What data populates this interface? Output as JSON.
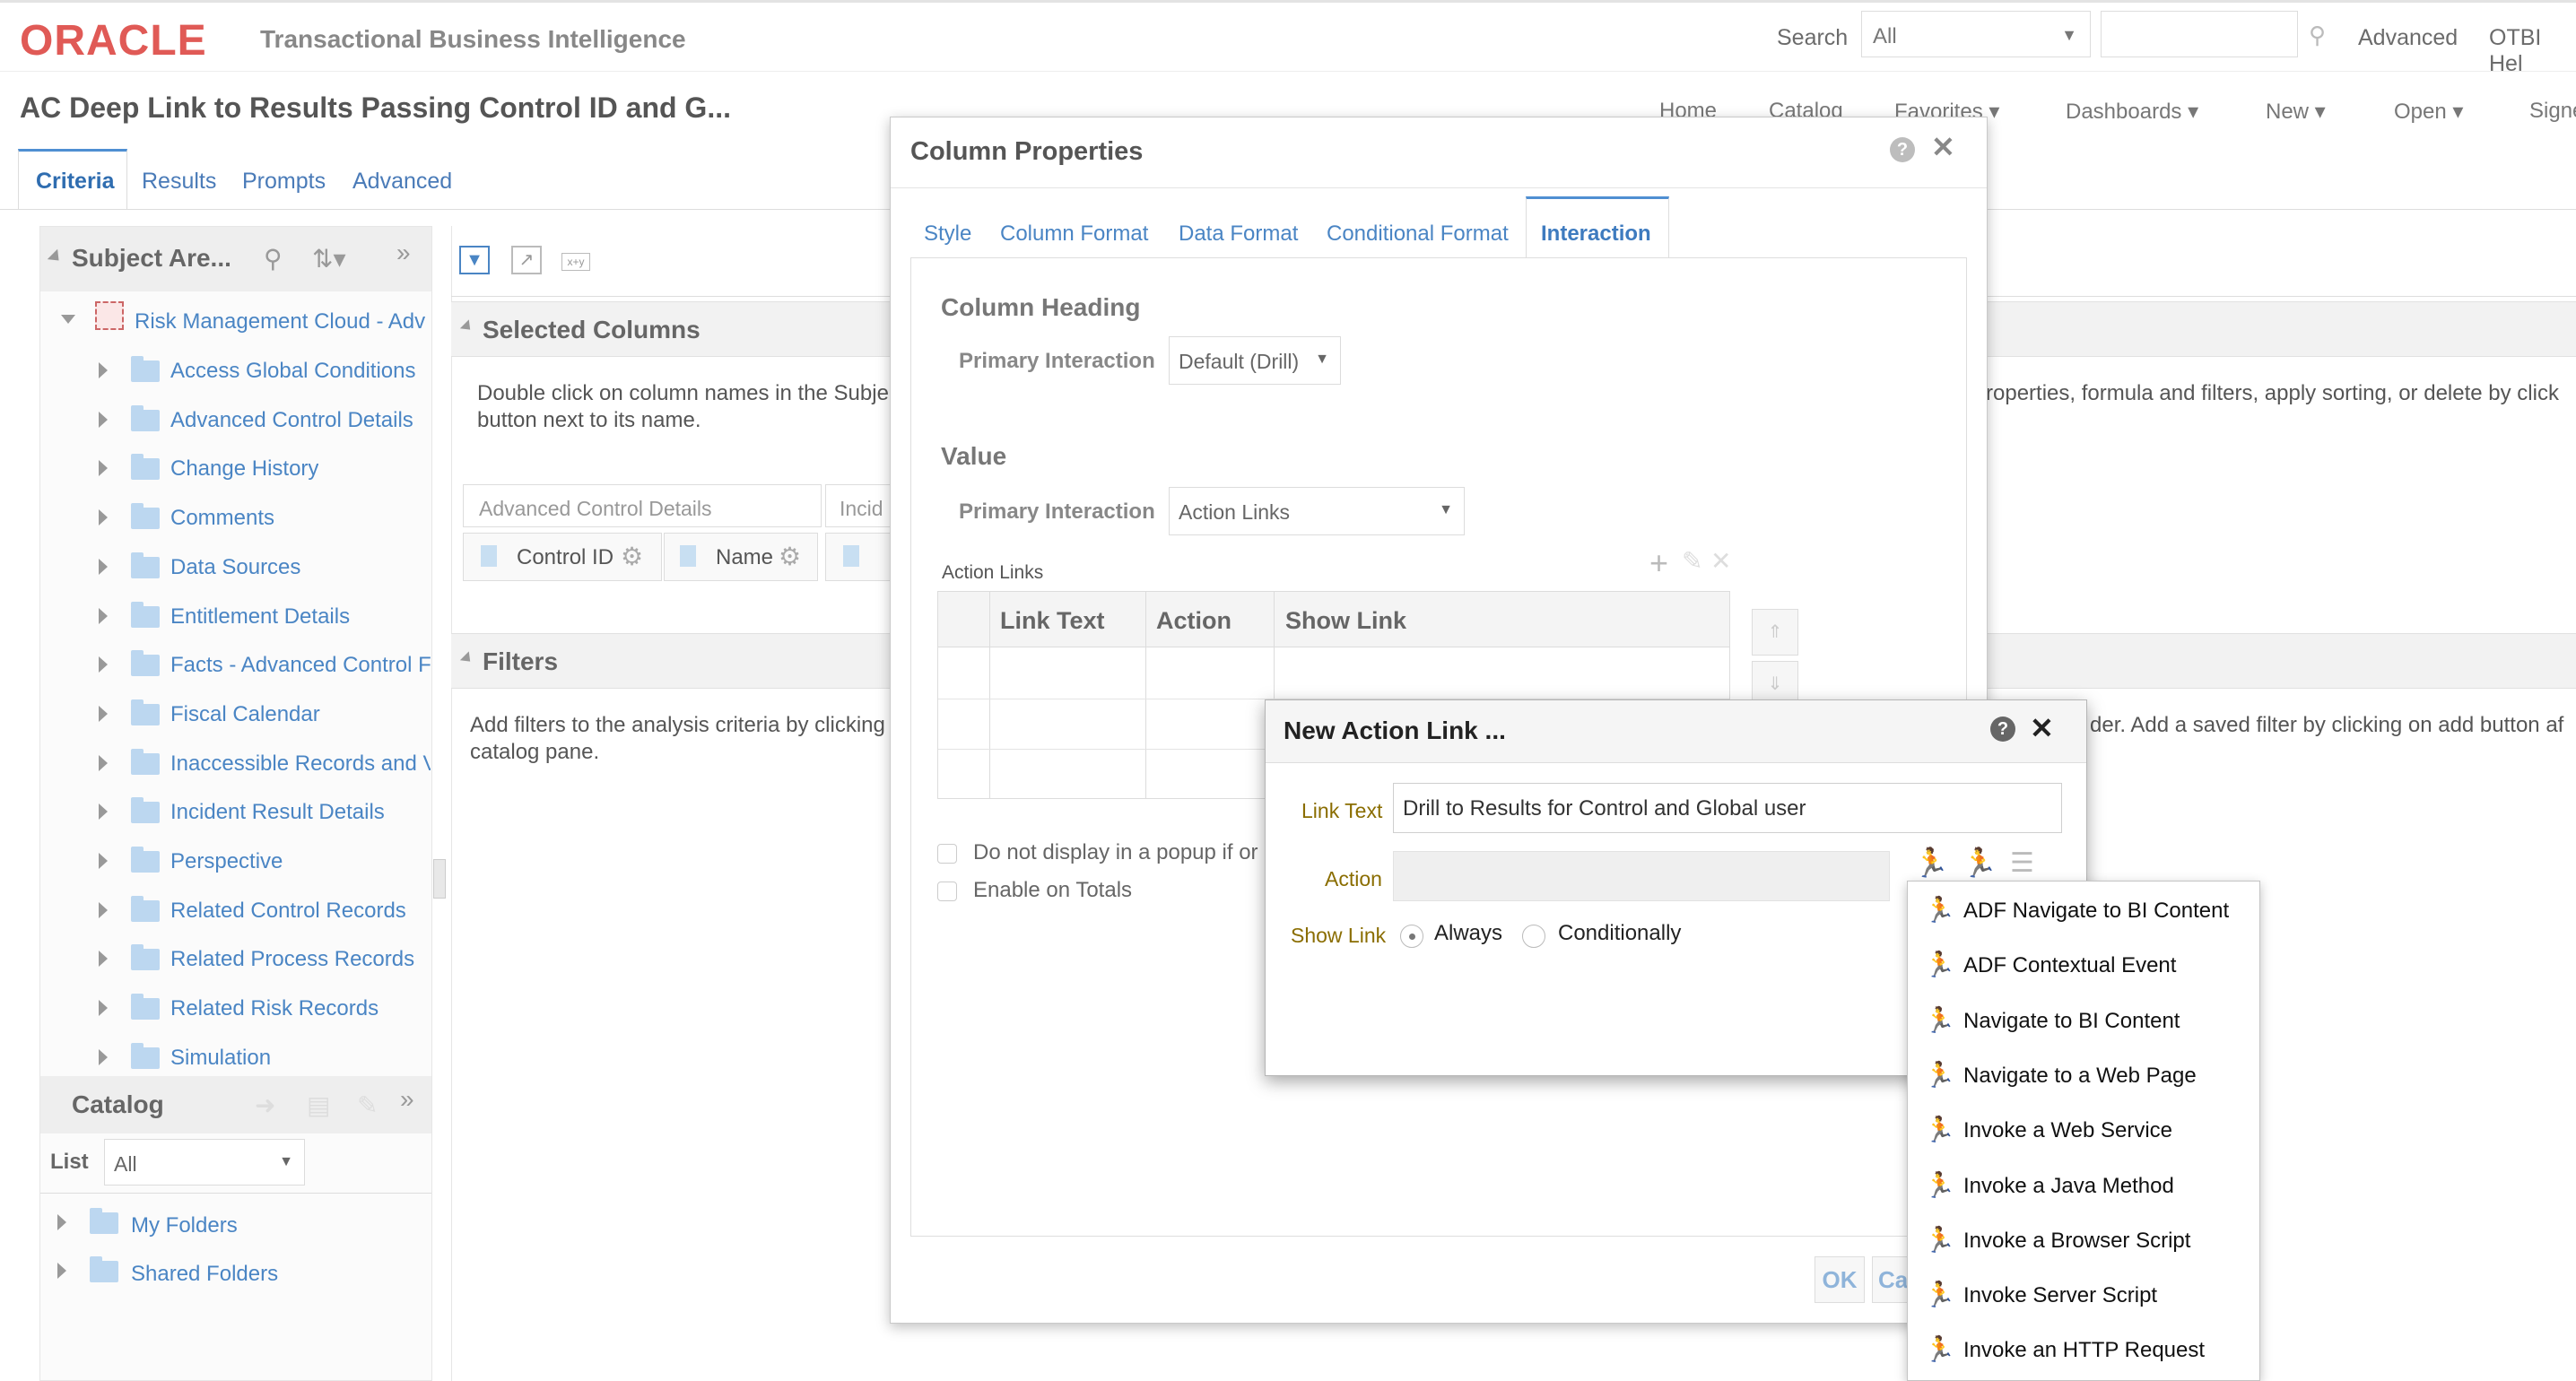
{
  "brand": {
    "logo": "ORACLE",
    "product": "Transactional Business Intelligence"
  },
  "header": {
    "search_label": "Search",
    "search_scope": "All",
    "advanced_label": "Advanced",
    "help_label": "OTBI Hel"
  },
  "page": {
    "title": "AC Deep Link to Results Passing Control ID and G..."
  },
  "nav": {
    "home": "Home",
    "catalog": "Catalog",
    "favorites": "Favorites",
    "dashboards": "Dashboards",
    "new": "New",
    "open": "Open",
    "signout": "Signe"
  },
  "editor_tabs": [
    "Criteria",
    "Results",
    "Prompts",
    "Advanced"
  ],
  "subject_areas": {
    "title": "Subject Are...",
    "root": "Risk Management Cloud - Adv",
    "items": [
      "Access Global Conditions",
      "Advanced Control Details",
      "Change History",
      "Comments",
      "Data Sources",
      "Entitlement Details",
      "Facts - Advanced Control F",
      "Fiscal Calendar",
      "Inaccessible Records and V",
      "Incident Result Details",
      "Perspective",
      "Related Control Records",
      "Related Process Records",
      "Related Risk Records",
      "Simulation"
    ]
  },
  "catalog": {
    "title": "Catalog",
    "list_label": "List",
    "list_value": "All",
    "folders": [
      "My Folders",
      "Shared Folders"
    ]
  },
  "selected_columns": {
    "title": "Selected Columns",
    "help_line1": "Double click on column names in the Subje",
    "help_line2": "button next to its name.",
    "help_right": "roperties, formula and filters, apply sorting, or delete by click",
    "group_header": "Advanced Control Details",
    "group_header2": "Incid",
    "columns": [
      "Control ID",
      "Name"
    ]
  },
  "filters": {
    "title": "Filters",
    "help_line1": "Add filters to the analysis criteria by clicking",
    "help_line2": "catalog pane.",
    "help_right": "der. Add a saved filter by clicking on add button af"
  },
  "column_properties": {
    "title": "Column Properties",
    "tabs": [
      "Style",
      "Column Format",
      "Data Format",
      "Conditional Format",
      "Interaction"
    ],
    "column_heading_label": "Column Heading",
    "primary_interaction_label": "Primary Interaction",
    "heading_interaction_value": "Default (Drill)",
    "value_label": "Value",
    "value_interaction_value": "Action Links",
    "action_links_label": "Action Links",
    "grid_headers": [
      "Link Text",
      "Action",
      "Show Link"
    ],
    "no_popup_label": "Do not display in a popup if or",
    "enable_totals_label": "Enable on Totals",
    "ok_label": "OK",
    "cancel_label": "Ca"
  },
  "new_action_link": {
    "title": "New Action Link ...",
    "link_text_label": "Link Text",
    "link_text_value": "Drill to Results for Control and Global user",
    "action_label": "Action",
    "show_link_label": "Show Link",
    "always_label": "Always",
    "conditionally_label": "Conditionally"
  },
  "action_menu": {
    "items": [
      "ADF Navigate to BI Content",
      "ADF Contextual Event",
      "Navigate to BI Content",
      "Navigate to a Web Page",
      "Invoke a Web Service",
      "Invoke a Java Method",
      "Invoke a Browser Script",
      "Invoke Server Script",
      "Invoke an HTTP Request"
    ]
  },
  "colors": {
    "brand_red": "#e05a56",
    "link_blue": "#4a85c4",
    "menu_icon_green": "#37a25b",
    "label_gold": "#8a6d00"
  }
}
